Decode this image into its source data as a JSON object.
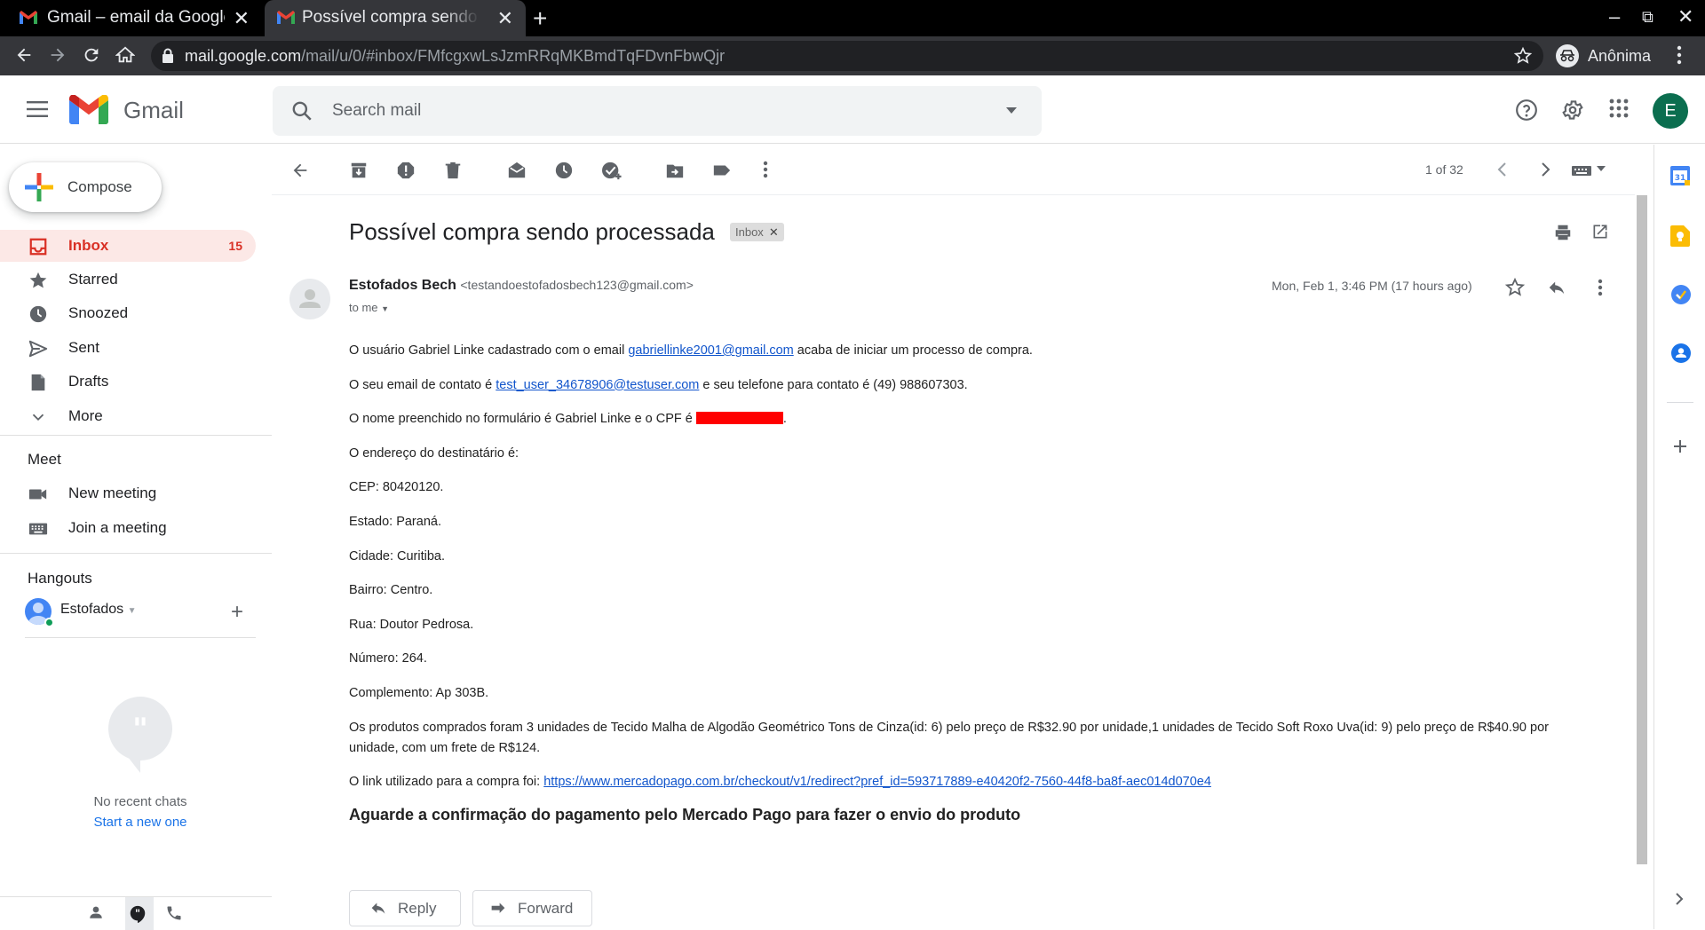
{
  "browser": {
    "tabs": [
      {
        "title": "Gmail – email da Google",
        "active": false
      },
      {
        "title": "Possível compra sendo processada",
        "active": true
      }
    ],
    "url_host": "mail.google.com",
    "url_path": "/mail/u/0/#inbox/FMfcgxwLsJzmRRqMKBmdTqFDvnFbwQjr",
    "profile_label": "Anônima"
  },
  "header": {
    "app_name": "Gmail",
    "search_placeholder": "Search mail",
    "avatar_letter": "E"
  },
  "sidebar": {
    "compose_label": "Compose",
    "items": [
      {
        "label": "Inbox",
        "count": "15",
        "icon": "inbox-icon"
      },
      {
        "label": "Starred",
        "count": "",
        "icon": "star-icon"
      },
      {
        "label": "Snoozed",
        "count": "",
        "icon": "clock-icon"
      },
      {
        "label": "Sent",
        "count": "",
        "icon": "send-icon"
      },
      {
        "label": "Drafts",
        "count": "",
        "icon": "draft-icon"
      },
      {
        "label": "More",
        "count": "",
        "icon": "chevron-down-icon"
      }
    ],
    "meet": {
      "title": "Meet",
      "new_meeting": "New meeting",
      "join_meeting": "Join a meeting"
    },
    "hangouts": {
      "title": "Hangouts",
      "user": "Estofados",
      "no_chats": "No recent chats",
      "start_new": "Start a new one"
    }
  },
  "message": {
    "pager": "1 of 32",
    "subject": "Possível compra sendo processada",
    "label": "Inbox",
    "sender_name": "Estofados Bech",
    "sender_email": "<testandoestofadosbech123@gmail.com>",
    "to": "to me",
    "date": "Mon, Feb 1, 3:46 PM (17 hours ago)",
    "body": {
      "p1_a": "O usuário Gabriel Linke cadastrado com o email ",
      "p1_link": "gabriellinke2001@gmail.com",
      "p1_b": " acaba de iniciar um processo de compra.",
      "p2_a": "O seu email de contato é ",
      "p2_link": "test_user_34678906@testuser.com",
      "p2_b": " e seu telefone para contato é (49) 988607303.",
      "p3_a": "O nome preenchido no formulário é Gabriel Linke e o CPF é ",
      "p3_b": ".",
      "p4": "O endereço do destinatário é:",
      "p5": "CEP: 80420120.",
      "p6": "Estado: Paraná.",
      "p7": "Cidade: Curitiba.",
      "p8": "Bairro: Centro.",
      "p9": "Rua: Doutor Pedrosa.",
      "p10": "Número: 264.",
      "p11": "Complemento: Ap 303B.",
      "p12": "Os produtos comprados foram 3 unidades de Tecido Malha de Algodão Geométrico Tons de Cinza(id: 6) pelo preço de R$32.90 por unidade,1 unidades de Tecido Soft Roxo Uva(id: 9) pelo preço de R$40.90 por unidade, com um frete de R$124.",
      "p13_a": "O link utilizado para a compra foi: ",
      "p13_link": "https://www.mercadopago.com.br/checkout/v1/redirect?pref_id=593717889-e40420f2-7560-44f8-ba8f-aec014d070e4",
      "heading": "Aguarde a confirmação do pagamento pelo Mercado Pago para fazer o envio do produto"
    },
    "reply_label": "Reply",
    "forward_label": "Forward"
  },
  "colors": {
    "accent_red": "#d93025",
    "link_blue": "#1155cc",
    "redaction": "#ff0000"
  }
}
